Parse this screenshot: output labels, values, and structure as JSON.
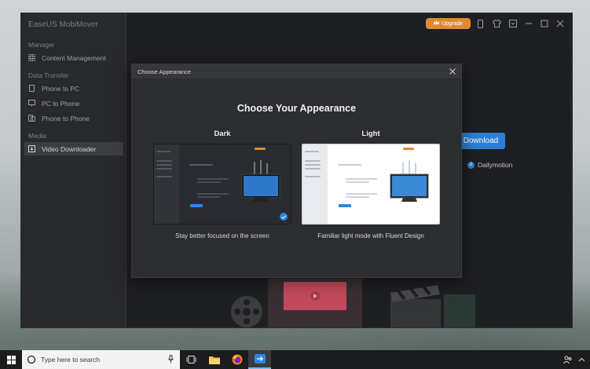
{
  "app": {
    "brand": "EaseUS MobiMover",
    "upgrade_label": "Upgrade"
  },
  "sidebar": {
    "sections": [
      {
        "label": "Manager"
      },
      {
        "label": "Data Transfer"
      },
      {
        "label": "Media"
      }
    ],
    "items": [
      {
        "label": "Content Management",
        "icon": "grid-icon"
      },
      {
        "label": "Phone to PC",
        "icon": "phone-icon"
      },
      {
        "label": "PC to Phone",
        "icon": "phone-icon"
      },
      {
        "label": "Phone to Phone",
        "icon": "phone-icon"
      },
      {
        "label": "Video Downloader",
        "icon": "download-icon",
        "active": true
      }
    ]
  },
  "main": {
    "download_label": "Download",
    "site_label": "Dailymotion"
  },
  "modal": {
    "header": "Choose Appearance",
    "title": "Choose Your Appearance",
    "options": [
      {
        "label": "Dark",
        "description": "Stay better focused on the screen",
        "selected": true
      },
      {
        "label": "Light",
        "description": "Familiar light mode with Fluent Design",
        "selected": false
      }
    ]
  },
  "taskbar": {
    "search_placeholder": "Type here to search"
  },
  "colors": {
    "accent": "#2a7fd4",
    "upgrade": "#e08a2e"
  }
}
